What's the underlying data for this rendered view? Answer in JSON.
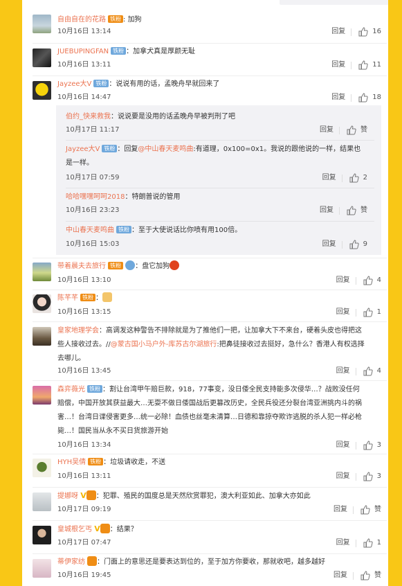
{
  "common": {
    "reply_label": "回复",
    "zan_label": "赞"
  },
  "comments": [
    {
      "user": "自由自在的花路",
      "badge": "铁粉",
      "badge_style": "gold",
      "sep": ": ",
      "text": "加狗",
      "time": "10月16日 13:14",
      "likes": "16"
    },
    {
      "user": "JUEBUPINGFAN",
      "badge": "铁粉",
      "badge_style": "tie",
      "sep": "：",
      "text": "加拿犬真是厚颜无耻",
      "time": "10月16日 13:11",
      "likes": "11"
    },
    {
      "user": "Jayzee大V",
      "badge": "铁粉",
      "badge_style": "tie",
      "sep": "：",
      "text": "说说有用的话，孟晚舟早就回来了",
      "time": "10月16日 14:47",
      "likes": "18"
    },
    {
      "user": "带着晨夫去旅行",
      "badge": "铁粉",
      "badge_style": "gold",
      "sep": "：",
      "text": "盘它加狗",
      "time": "10月16日 13:10",
      "likes": "4"
    },
    {
      "user": "陈芊芊",
      "badge": "铁粉",
      "badge_style": "gold",
      "sep": "：",
      "text": "",
      "time": "10月16日 13:15",
      "likes": "1"
    },
    {
      "user": "皇家地理学会",
      "sep": "：",
      "text": "高调发这种警告不排除就是为了推他们一把，让加拿大下不来台，硬着头皮也得把这些人接收过去。//",
      "mention": "@蒙古国小马户外-库苏古尔湖旅行",
      "text2": ":把鼻徒接收过去挺好，急什么？香港人有权选择去哪儿。",
      "time": "10月16日 13:45",
      "likes": "4"
    },
    {
      "user": "森弈薇光",
      "badge": "铁粉",
      "badge_style": "tie",
      "sep": "：",
      "text": "割让台湾甲午赔巨款，918，77事变，没日倭全民支持能多次侵华…？战败没任何赔偿，中国开放其获益最大…无耍不做日倭国战后更篡改历史，全民兵役还分裂台湾亚洲挑内斗的祸害…！台湾日谍侵害更多…统一必除！血债也丝毫未清算…日德和靠掠夺欺诈逃脱的杀人犯一样必枪毙…！国民当从永不买日货旅游开始",
      "time": "10月16日 13:34",
      "likes": "3"
    },
    {
      "user": "HYH吴倩",
      "badge": "铁粉",
      "badge_style": "gold",
      "sep": "：",
      "text": "垃圾请收走，不送",
      "time": "10月16日 13:11",
      "likes": "3"
    },
    {
      "user": "提娜呀",
      "sep": "：",
      "text": "犯罪、殖民的国度总是天然欣赏罪犯，澳大利亚如此、加拿大亦如此",
      "time": "10月17日 09:19",
      "likes": "赞"
    },
    {
      "user": "皇城根乞丐",
      "sep": "：",
      "text": "结果？",
      "time": "10月17日 07:47",
      "likes": "1"
    },
    {
      "user": "蒂伊家纺",
      "sep": "：",
      "text": "门面上的意思还是要表达到位的，至于加方你要收，那就收吧，越多越好",
      "time": "10月16日 19:45",
      "likes": "赞"
    }
  ],
  "replies": [
    {
      "user": "伯约_快来救我",
      "sep": "：",
      "text": "说说要是没用的话孟晚舟早被判刑了吧",
      "time": "10月17日 11:17",
      "likes": "赞"
    },
    {
      "user": "Jayzee大V",
      "badge": "铁粉",
      "sep": "：回复",
      "mention": "@中山春天麦鸣曲",
      "text": ":有道理，0x100=0x1。我说的跟他说的一样，结果也是一样。",
      "time": "10月17日 07:59",
      "likes": "2"
    },
    {
      "user": "哈哈嘿嘿呵呵2018",
      "sep": "：",
      "text": "特朗普说的管用",
      "time": "10月16日 23:23",
      "likes": "赞"
    },
    {
      "user": "中山春天麦鸣曲",
      "badge": "铁粉",
      "sep": "：",
      "text": "至于大使说话比你喷有用100倍。",
      "time": "10月16日 15:03",
      "likes": "9"
    }
  ],
  "colors": {
    "accent": "#eb7350",
    "background": "#f9c716",
    "reply_bg": "#f2f2f5"
  }
}
